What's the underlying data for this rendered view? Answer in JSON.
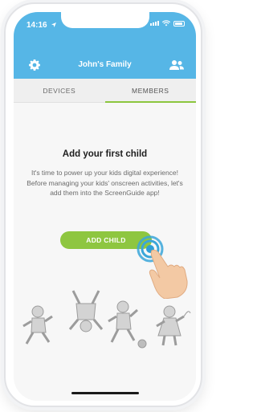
{
  "status_bar": {
    "time": "14:16"
  },
  "header": {
    "title": "John's Family"
  },
  "tabs": [
    {
      "label": "DEVICES",
      "active": false
    },
    {
      "label": "MEMBERS",
      "active": true
    }
  ],
  "empty_state": {
    "heading": "Add your first child",
    "description": "It's time to power up your kids digital experience! Before managing your kids' onscreen activities, let's add them into the ScreenGuide app!",
    "button_label": "ADD CHILD"
  },
  "colors": {
    "header_blue": "#56b6e6",
    "accent_green": "#8ec640",
    "tab_underline": "#8cc63f"
  },
  "icons": [
    "settings-gear-icon",
    "add-member-icon",
    "tap-gesture-hand-icon",
    "wifi-icon",
    "battery-icon",
    "signal-icon",
    "location-arrow-icon"
  ]
}
